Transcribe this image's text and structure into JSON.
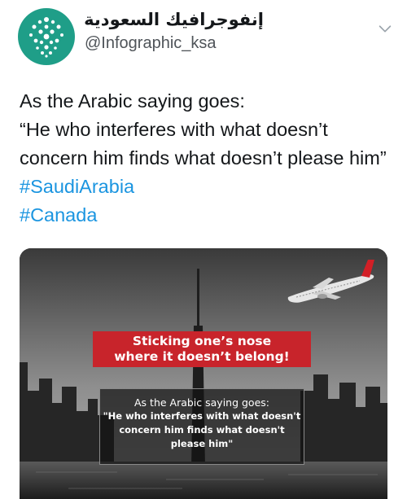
{
  "account": {
    "display_name": "إنفوجرافيك السعودية",
    "handle": "@Infographic_ksa",
    "verified": true,
    "avatar_color": "#1f9e88"
  },
  "tweet": {
    "line1": "As the Arabic saying goes:",
    "quote_part1": "“He who interferes with what doesn’t concern him finds what doesn’t please him”",
    "hashtag1": "#SaudiArabia",
    "hashtag2": "#Canada",
    "hashtag_color": "#1b95e0"
  },
  "media": {
    "banner_line1": "Sticking one’s nose",
    "banner_line2": "where it doesn’t belong!",
    "banner_color": "#c8242b",
    "quote_title": "As the Arabic saying goes:",
    "quote_line1": "\"He who interferes with what doesn't",
    "quote_line2": "concern him finds what doesn't",
    "quote_line3": "please him\""
  },
  "icons": {
    "avatar": "dots-logo-icon",
    "verified": "verified-badge-icon",
    "menu": "chevron-down-icon",
    "plane": "airplane-icon"
  }
}
